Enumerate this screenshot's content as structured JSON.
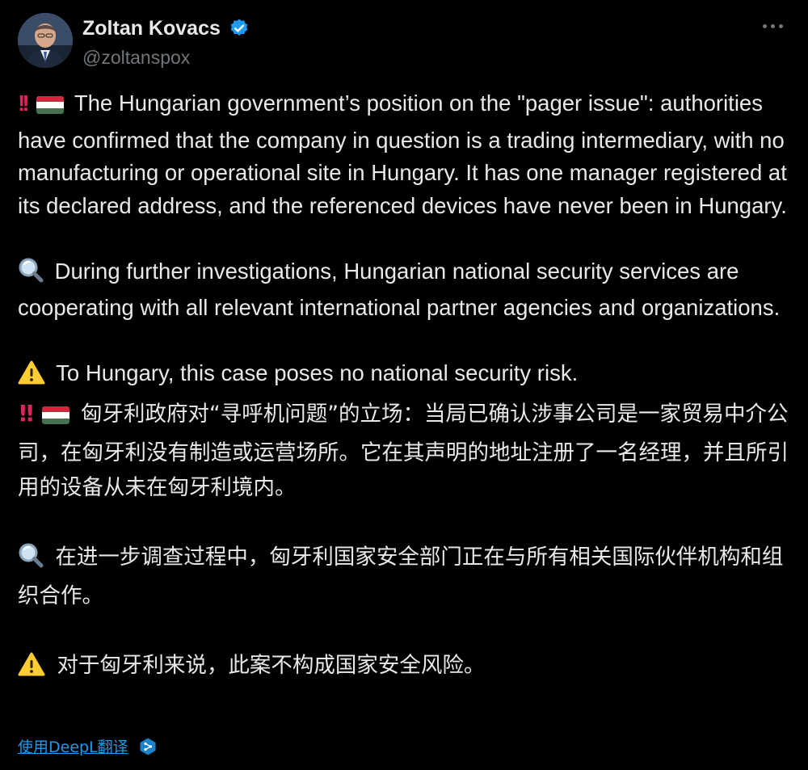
{
  "author": {
    "display_name": "Zoltan Kovacs",
    "handle": "@zoltanspox",
    "verified": true,
    "avatar_icon": "portrait-avatar"
  },
  "post": {
    "en": {
      "p1": "The Hungarian government’s position on the \"pager issue\": authorities have confirmed that the company in question is a trading intermediary, with no manufacturing or operational site in Hungary. It has one manager registered at its declared address, and the referenced devices have never been in Hungary.",
      "p2": "During further investigations, Hungarian national security services are cooperating with all relevant international partner agencies and organizations.",
      "p3": "To Hungary, this case poses no national security risk."
    },
    "zh": {
      "p1": "匈牙利政府对“寻呼机问题”的立场：当局已确认涉事公司是一家贸易中介公司，在匈牙利没有制造或运营场所。它在其声明的地址注册了一名经理，并且所引用的设备从未在匈牙利境内。",
      "p2": "在进一步调查过程中，匈牙利国家安全部门正在与所有相关国际伙伴机构和组织合作。",
      "p3": "对于匈牙利来说，此案不构成国家安全风险。"
    }
  },
  "icons": {
    "p1": [
      "double-exclamation-icon",
      "hungary-flag-icon"
    ],
    "p2": "magnifying-glass-icon",
    "p3": "warning-icon"
  },
  "translate": {
    "label": "使用DeepL翻译",
    "icon": "deepl-icon"
  },
  "colors": {
    "background": "#000000",
    "text": "#e7e9ea",
    "secondary": "#71767b",
    "link": "#1d9bf0",
    "verified": "#1d9bf0"
  }
}
